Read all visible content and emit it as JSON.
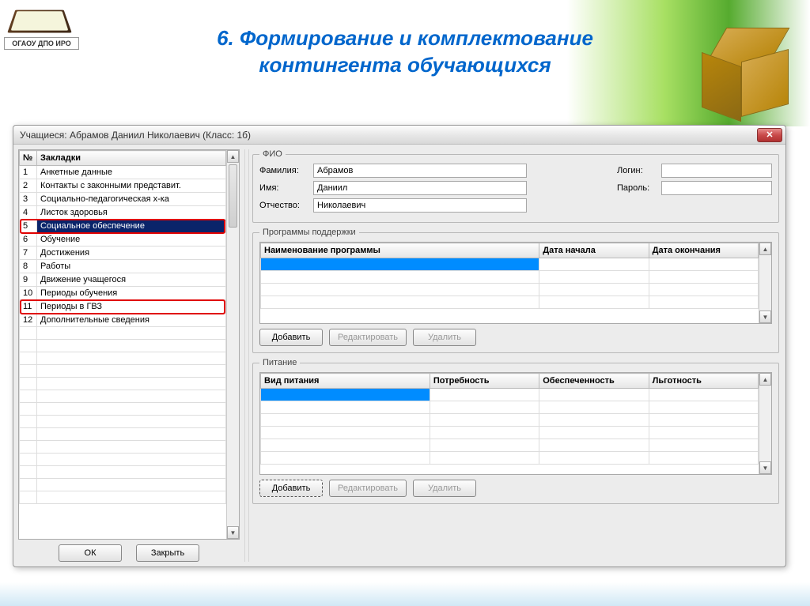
{
  "slide": {
    "title_line1": "6. Формирование и комплектование",
    "title_line2": "контингента обучающихся",
    "logo_text": "ОГАОУ ДПО ИРО"
  },
  "window": {
    "title": "Учащиеся: Абрамов Даниил Николаевич (Класс: 1б)"
  },
  "bookmarks": {
    "header_num": "№",
    "header_name": "Закладки",
    "items": [
      {
        "n": "1",
        "label": "Анкетные данные"
      },
      {
        "n": "2",
        "label": "Контакты с законными представит."
      },
      {
        "n": "3",
        "label": "Социально-педагогическая х-ка"
      },
      {
        "n": "4",
        "label": "Листок здоровья"
      },
      {
        "n": "5",
        "label": "Социальное обеспечение"
      },
      {
        "n": "6",
        "label": "Обучение"
      },
      {
        "n": "7",
        "label": "Достижения"
      },
      {
        "n": "8",
        "label": "Работы"
      },
      {
        "n": "9",
        "label": "Движение учащегося"
      },
      {
        "n": "10",
        "label": "Периоды обучения"
      },
      {
        "n": "11",
        "label": "Периоды в ГВЗ"
      },
      {
        "n": "12",
        "label": "Дополнительные сведения"
      }
    ],
    "selected_index": 4,
    "highlight_indices": [
      4,
      10
    ]
  },
  "fio": {
    "legend": "ФИО",
    "surname_label": "Фамилия:",
    "surname_value": "Абрамов",
    "name_label": "Имя:",
    "name_value": "Даниил",
    "patronymic_label": "Отчество:",
    "patronymic_value": "Николаевич",
    "login_label": "Логин:",
    "login_value": "",
    "password_label": "Пароль:",
    "password_value": ""
  },
  "programs": {
    "legend": "Программы поддержки",
    "col_name": "Наименование программы",
    "col_start": "Дата начала",
    "col_end": "Дата окончания"
  },
  "food": {
    "legend": "Питание",
    "col_type": "Вид питания",
    "col_need": "Потребность",
    "col_supply": "Обеспеченность",
    "col_benefit": "Льготность"
  },
  "buttons": {
    "ok": "ОК",
    "close": "Закрыть",
    "add": "Добавить",
    "edit": "Редактировать",
    "delete": "Удалить"
  }
}
